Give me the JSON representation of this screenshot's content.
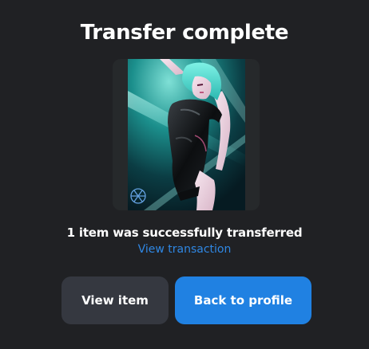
{
  "dialog": {
    "title": "Transfer complete",
    "status_text": "1 item was successfully transferred",
    "view_transaction_link": "View transaction",
    "view_item_button": "View item",
    "back_to_profile_button": "Back to profile"
  },
  "artwork": {
    "image_alt": "anime-girl-artwork",
    "watermark_icon": "emblem-icon"
  },
  "colors": {
    "background": "#202124",
    "primary_button": "#2081e2",
    "secondary_button": "#353840",
    "link": "#2f87e3"
  }
}
